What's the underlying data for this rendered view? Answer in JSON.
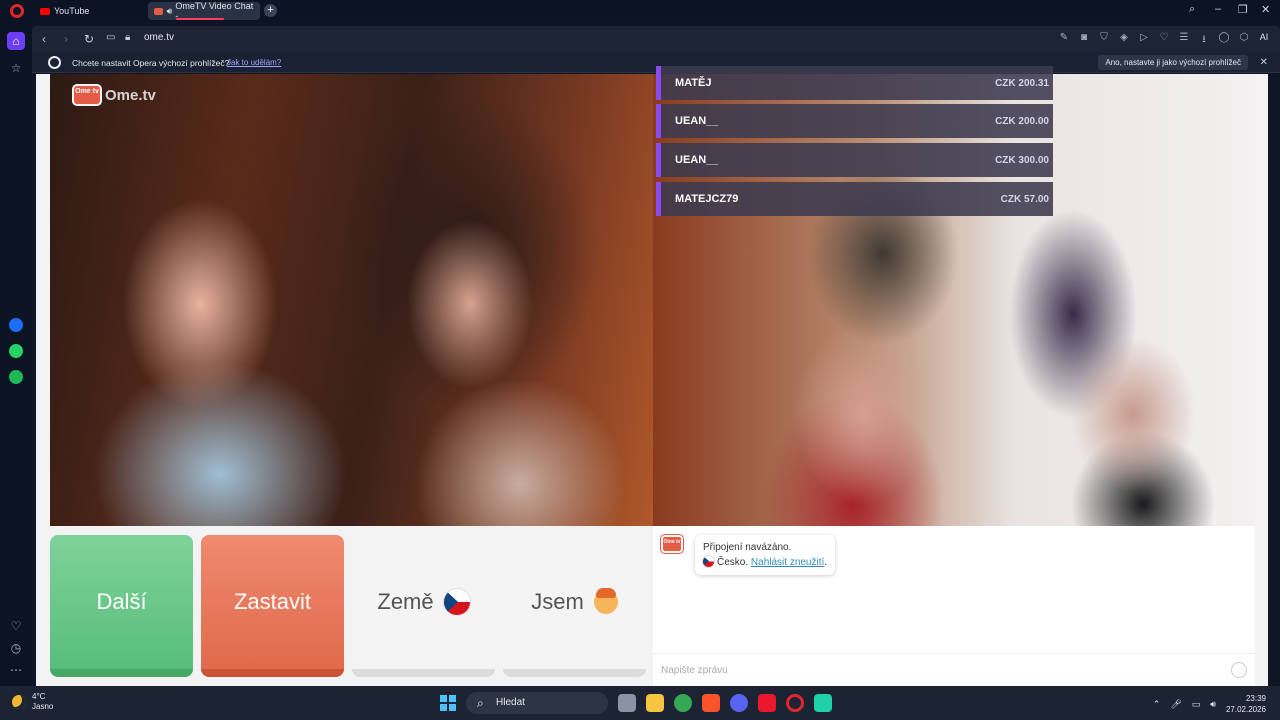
{
  "browser": {
    "tabs": [
      {
        "label": "YouTube"
      },
      {
        "label": "OmeTV Video Chat -..."
      }
    ],
    "url": "ome.tv",
    "ai_label": "AI"
  },
  "infobar": {
    "text": "Chcete nastavit Opera výchozí prohlížeč?",
    "link": "Jak to udělám?",
    "button": "Ano, nastavte ji jako výchozí prohlížeč"
  },
  "page": {
    "logo_small": "Ome tv",
    "logo_text": "Ome.tv",
    "donations": [
      {
        "name": "MATĚJ",
        "amount": "CZK 200.31"
      },
      {
        "name": "UEAN__",
        "amount": "CZK 200.00"
      },
      {
        "name": "UEAN__",
        "amount": "CZK 300.00"
      },
      {
        "name": "MATEJCZ79",
        "amount": "CZK 57.00"
      }
    ],
    "buttons": {
      "next": "Další",
      "stop": "Zastavit",
      "country": "Země",
      "iam": "Jsem"
    },
    "chat": {
      "status": "Připojení navázáno.",
      "country": "Česko.",
      "report": "Nahlásit zneužití",
      "placeholder": "Napište zprávu"
    }
  },
  "taskbar": {
    "temp": "4°C",
    "weather": "Jasno",
    "search": "Hledat",
    "time": "23:39",
    "date": "27.02.2026"
  },
  "colors": {
    "next": "#58be7a",
    "stop": "#e06a4c",
    "donation_accent": "#8a4cf0",
    "link": "#2e8fb8"
  }
}
